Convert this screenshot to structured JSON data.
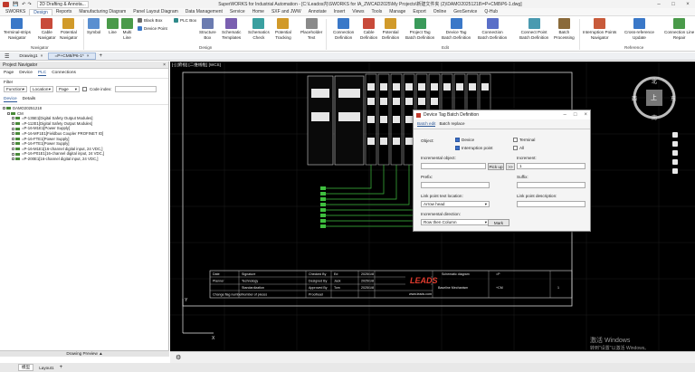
{
  "window": {
    "title": "SuperWORKS for Industrial Automation - [C:\\Leados内\\SWORKS for IA_ZWCAD2025\\My Projects\\新建文件夹 (2)\\DAMO20251218\\=P+CM8\\P6-1.dwg]",
    "qat_label": "2D Drafting & Annota..."
  },
  "ribbon_tabs": [
    "SWORKS",
    "Design",
    "Reports",
    "Manufacturing Diagram",
    "Panel Layout Diagram",
    "Data Management",
    "Service",
    "Home",
    "SXF and JWW",
    "Annotate",
    "Insert",
    "Views",
    "Tools",
    "Manage",
    "Export",
    "Online",
    "GeoService",
    "Q-Hub"
  ],
  "ribbon_active": "Design",
  "ribbon": {
    "navigator": [
      {
        "label": "Terminal-strips\nNavigator",
        "color": "#3a78c8"
      },
      {
        "label": "Cable\nNavigator",
        "color": "#c84a3a"
      },
      {
        "label": "Potential\nNavigator",
        "color": "#d19a2a"
      }
    ],
    "navigator_group": "Navigator",
    "design_big": [
      {
        "label": "Symbol",
        "color": "#5a8fd0"
      },
      {
        "label": "Line",
        "color": "#4a9a4a"
      },
      {
        "label": "Multi\nLine",
        "color": "#4a9a4a"
      }
    ],
    "design_small": [
      {
        "label": "Black Box",
        "color": "#6b6b6b"
      },
      {
        "label": "Device Point",
        "color": "#3a78c8"
      },
      {
        "label": "PLC Box",
        "color": "#2e8a8a"
      }
    ],
    "design_big2": [
      {
        "label": "Structure\nBox",
        "color": "#6b7bb0"
      },
      {
        "label": "Schematic\nTemplates",
        "color": "#7a5fb0"
      },
      {
        "label": "Schematics\nCheck",
        "color": "#3aa0a0"
      },
      {
        "label": "Potential\nTracking",
        "color": "#d19a2a"
      },
      {
        "label": "Placeholder\nText",
        "color": "#8a8a8a"
      }
    ],
    "design_group": "Design",
    "edit_big": [
      {
        "label": "Connection\nDefinition",
        "color": "#3a78c8"
      },
      {
        "label": "Cable\nDefinition",
        "color": "#c84a3a"
      },
      {
        "label": "Potential\nDefinition",
        "color": "#d19a2a"
      },
      {
        "label": "Project Tag\nBatch Definition",
        "color": "#3a9a5a"
      },
      {
        "label": "Device Tag\nBatch Definition",
        "color": "#3a78c8"
      },
      {
        "label": "Connection\nBatch Definition",
        "color": "#5a6fc8"
      },
      {
        "label": "Connect Point\nBatch Definition",
        "color": "#4a9ab0"
      },
      {
        "label": "Batch\nProcessing",
        "color": "#8a6a3a"
      }
    ],
    "edit_group": "Edit",
    "ref_big": [
      {
        "label": "Interruption Points\nNavigator",
        "color": "#c85a3a"
      },
      {
        "label": "Cross-reference\nUpdate",
        "color": "#3a78c8"
      },
      {
        "label": "Connection Line\nRepair",
        "color": "#4a9a4a"
      }
    ],
    "ref_group": "Reference"
  },
  "doc_tabs": [
    {
      "label": "Drawing1",
      "active": false
    },
    {
      "label": "=P+CM8/P6-1*",
      "active": true
    }
  ],
  "left_panel": {
    "title": "Project Navigator",
    "tabs": [
      "Page",
      "Device",
      "PLC",
      "Connections"
    ],
    "active_tab": "PLC",
    "filter_label": "Filter",
    "filters": [
      "Function",
      "Location",
      "Page"
    ],
    "code_index_label": "Code index:",
    "sub_tabs": [
      "Device",
      "Details"
    ],
    "tree": [
      {
        "text": "DAMO20251218",
        "level": 0
      },
      {
        "text": "CM",
        "level": 1
      },
      {
        "text": "=P-135E1[Digital Safety Output Modules]",
        "level": 2
      },
      {
        "text": "=P-112E1[Digital Safety Output Modules]",
        "level": 2
      },
      {
        "text": "=P-16-M1E1[Power Supply]",
        "level": 2
      },
      {
        "text": "=P-16-MF1E1[Fieldbus Coupler PROFINET IO]",
        "level": 2
      },
      {
        "text": "=P-16-FTE1[Power Supply]",
        "level": 2
      },
      {
        "text": "=P-16-FTE1[Power Supply]",
        "level": 2
      },
      {
        "text": "=P-16-M1E1[16-channel digital input, 24 VDC,]",
        "level": 2
      },
      {
        "text": "=P-16-P01E1[16-channel digital input, 24 VDC,]",
        "level": 2
      },
      {
        "text": "=P-200E1[16-channel digital input, 24 VDC,]",
        "level": 2
      }
    ],
    "preview_label": "Drawing Preview ▲"
  },
  "canvas": {
    "viewport_label": "[-] [俯视] [二维线框] [WCS]",
    "title_block": {
      "rows": [
        [
          "Date",
          "Signature",
          "Checked By",
          "Ed",
          "2025/1/8"
        ],
        [
          "Planner",
          "Technology",
          "Designed By",
          "Jack",
          "2025/1/8"
        ],
        [
          "",
          "Standardization",
          "Approved By",
          "Tom",
          "2025/1/8"
        ],
        [
          "Change flag number",
          "Number of pieces",
          "Proofread",
          "",
          ""
        ]
      ],
      "company_url": "www.leads.com",
      "drawing_title": "Schematic diagram",
      "subtitle": "Baseline Mechanism",
      "page_ref": "=P",
      "page_no": "+CM",
      "sheet": "1"
    },
    "nav_cube": {
      "north": "北",
      "south": "南",
      "east": "东",
      "west": "西",
      "face": "上"
    }
  },
  "dialog": {
    "title": "Device Tag Batch Definition",
    "tabs": [
      "Batch edit",
      "Batch replace"
    ],
    "object_label": "Object:",
    "checkboxes": [
      {
        "label": "Device",
        "checked": true
      },
      {
        "label": "Terminal",
        "checked": false
      },
      {
        "label": "Interruption point",
        "checked": true
      },
      {
        "label": "All",
        "checked": false
      }
    ],
    "incremental_object_label": "Incremental object:",
    "increment_label": "Increment:",
    "increment_value": "1",
    "pickup_label": "Pick up",
    "arrow_label": ">>",
    "prefix_label": "Prefix:",
    "suffix_label": "Suffix:",
    "link_point_text_location_label": "Link point text location:",
    "link_point_text_location_value": "Arrow head",
    "link_point_description_label": "Link point description:",
    "incremental_direction_label": "Incremental direction:",
    "incremental_direction_value": "Row then Column",
    "mark_label": "Mark"
  },
  "status": {
    "model_tabs": [
      "模型",
      "Layout1"
    ],
    "watermark_line1": "激活 Windows",
    "watermark_line2": "转到\"设置\"以激活 Windows。"
  }
}
